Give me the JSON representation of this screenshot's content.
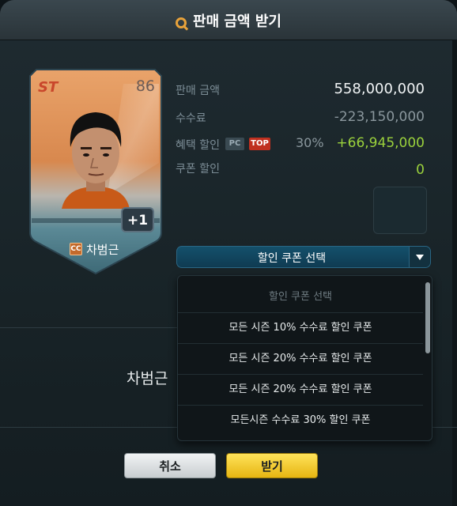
{
  "dialog": {
    "title": "판매 금액 받기",
    "title_icon": "search-icon"
  },
  "card": {
    "position": "ST",
    "overall": "86",
    "plus": "+1",
    "season_badge": "CC",
    "name": "차범근"
  },
  "sale": {
    "rows": [
      {
        "label": "판매 금액",
        "value": "558,000,000"
      },
      {
        "label": "수수료",
        "value": "-223,150,000"
      },
      {
        "label": "혜택 할인",
        "pc_badge": "PC",
        "top_badge": "TOP",
        "percent": "30%",
        "value": "+66,945,000"
      },
      {
        "label": "쿠폰 할인",
        "value": "0"
      }
    ]
  },
  "coupon_select": {
    "selected": "할인 쿠폰 선택",
    "options": [
      "할인 쿠폰 선택",
      "모든 시즌 10% 수수료 할인 쿠폰",
      "모든 시즌 20% 수수료 할인 쿠폰",
      "모든 시즌 20% 수수료 할인 쿠폰",
      "모든시즌 수수료 30% 할인 쿠폰"
    ]
  },
  "background": {
    "player_name": "차범근"
  },
  "buttons": {
    "cancel": "취소",
    "confirm": "받기"
  },
  "colors": {
    "accent_yellow": "#f5c928",
    "positive_green": "#9bd23c",
    "select_blue": "#14506b"
  }
}
